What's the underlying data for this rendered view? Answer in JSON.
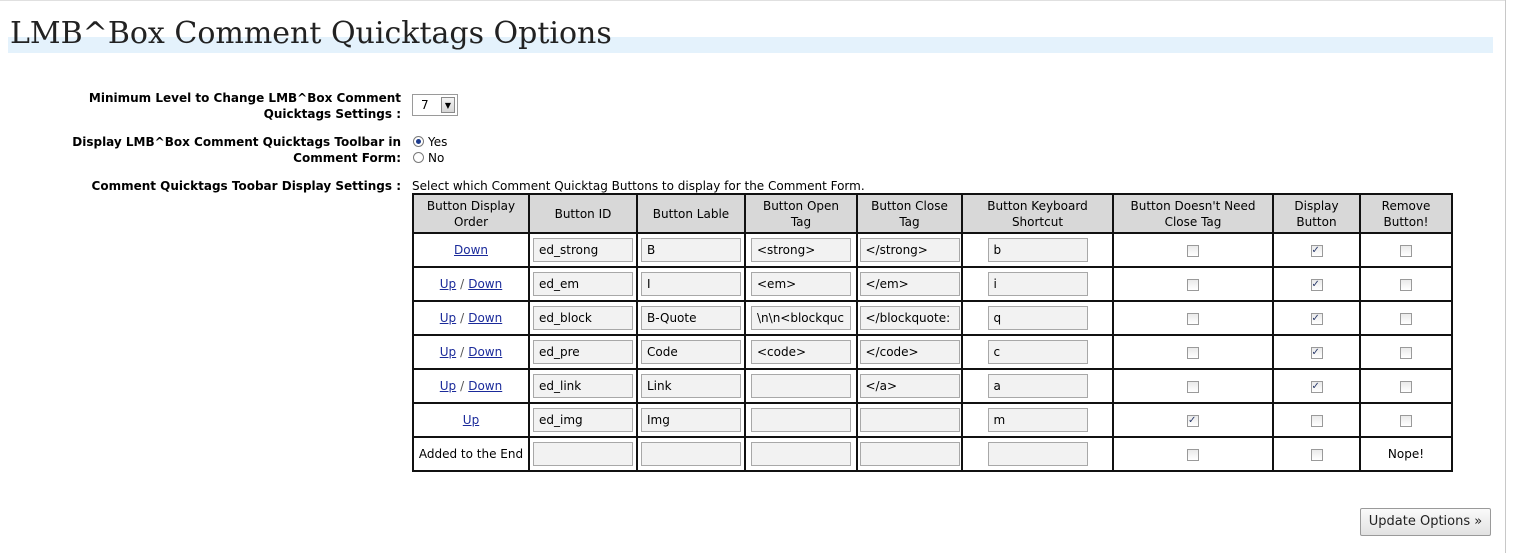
{
  "page": {
    "title": "LMB^Box Comment Quicktags Options"
  },
  "options": {
    "min_level": {
      "label_line1": "Minimum Level to Change LMB^Box Comment",
      "label_line2": "Quicktags Settings :",
      "value": "7",
      "arrow": "▼"
    },
    "display_toolbar": {
      "label_line1": "Display LMB^Box Comment Quicktags Toolbar in",
      "label_line2": "Comment Form:",
      "yes_label": "Yes",
      "no_label": "No",
      "selected": "Yes"
    },
    "toolbar_settings": {
      "label": "Comment Quicktags Toobar Display Settings :",
      "description": "Select which Comment Quicktag Buttons to display for the Comment Form."
    }
  },
  "table": {
    "headers": [
      {
        "line1": "Button Display",
        "line2": "Order"
      },
      {
        "line1": "Button ID",
        "line2": ""
      },
      {
        "line1": "Button Lable",
        "line2": ""
      },
      {
        "line1": "Button Open",
        "line2": "Tag"
      },
      {
        "line1": "Button Close",
        "line2": "Tag"
      },
      {
        "line1": "Button Keyboard",
        "line2": "Shortcut"
      },
      {
        "line1": "Button Doesn't Need",
        "line2": "Close Tag"
      },
      {
        "line1": "Display",
        "line2": "Button"
      },
      {
        "line1": "Remove",
        "line2": "Button!"
      }
    ],
    "up_label": "Up",
    "down_label": "Down",
    "separator": "/",
    "rows": [
      {
        "up": false,
        "down": true,
        "id": "ed_strong",
        "label": "B",
        "open": "<strong>",
        "close": "</strong>",
        "key": "b",
        "no_close": false,
        "display": true,
        "remove": false
      },
      {
        "up": true,
        "down": true,
        "id": "ed_em",
        "label": "I",
        "open": "<em>",
        "close": "</em>",
        "key": "i",
        "no_close": false,
        "display": true,
        "remove": false
      },
      {
        "up": true,
        "down": true,
        "id": "ed_block",
        "label": "B-Quote",
        "open": "\\n\\n<blockquc",
        "close": "</blockquote:",
        "key": "q",
        "no_close": false,
        "display": true,
        "remove": false
      },
      {
        "up": true,
        "down": true,
        "id": "ed_pre",
        "label": "Code",
        "open": "<code>",
        "close": "</code>",
        "key": "c",
        "no_close": false,
        "display": true,
        "remove": false
      },
      {
        "up": true,
        "down": true,
        "id": "ed_link",
        "label": "Link",
        "open": "",
        "close": "</a>",
        "key": "a",
        "no_close": false,
        "display": true,
        "remove": false
      },
      {
        "up": true,
        "down": false,
        "id": "ed_img",
        "label": "Img",
        "open": "",
        "close": "",
        "key": "m",
        "no_close": true,
        "display": false,
        "remove": false
      }
    ],
    "new_row": {
      "order_text": "Added to the End",
      "remove_text": "Nope!",
      "no_close": false,
      "display": false
    }
  },
  "buttons": {
    "update": "Update Options »"
  }
}
